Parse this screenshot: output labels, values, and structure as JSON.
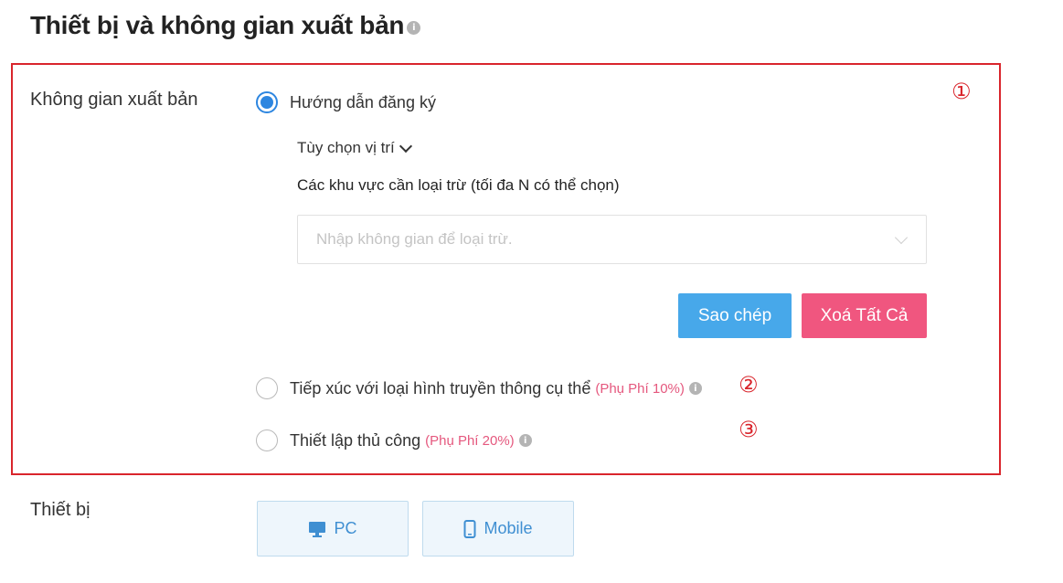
{
  "page": {
    "title": "Thiết bị và không gian xuất bản",
    "info_icon": "info-icon"
  },
  "markers": [
    "①",
    "②",
    "③"
  ],
  "publish_space": {
    "label": "Không gian xuất bản",
    "options": [
      {
        "label": "Hướng dẫn đăng ký",
        "selected": true,
        "fee": ""
      },
      {
        "label": "Tiếp xúc với loại hình truyền thông cụ thể",
        "selected": false,
        "fee": "(Phụ Phí 10%)"
      },
      {
        "label": "Thiết lập thủ công",
        "selected": false,
        "fee": "(Phụ Phí 20%)"
      }
    ],
    "location_toggle": "Tùy chọn vị trí",
    "exclude_label": "Các khu vực cần loại trừ (tối đa N có thể chọn)",
    "exclude_placeholder": "Nhập không gian để loại trừ.",
    "copy_button": "Sao chép",
    "clear_button": "Xoá Tất Cả"
  },
  "device": {
    "label": "Thiết bị",
    "options": [
      {
        "label": "PC",
        "icon": "monitor-icon"
      },
      {
        "label": "Mobile",
        "icon": "smartphone-icon"
      }
    ]
  },
  "colors": {
    "highlight_border": "#d9252c",
    "radio_selected": "#2d86e0",
    "fee_text": "#e5587e",
    "copy_button": "#47a8ea",
    "clear_button": "#f0567f",
    "device_text": "#3f8fd2"
  }
}
